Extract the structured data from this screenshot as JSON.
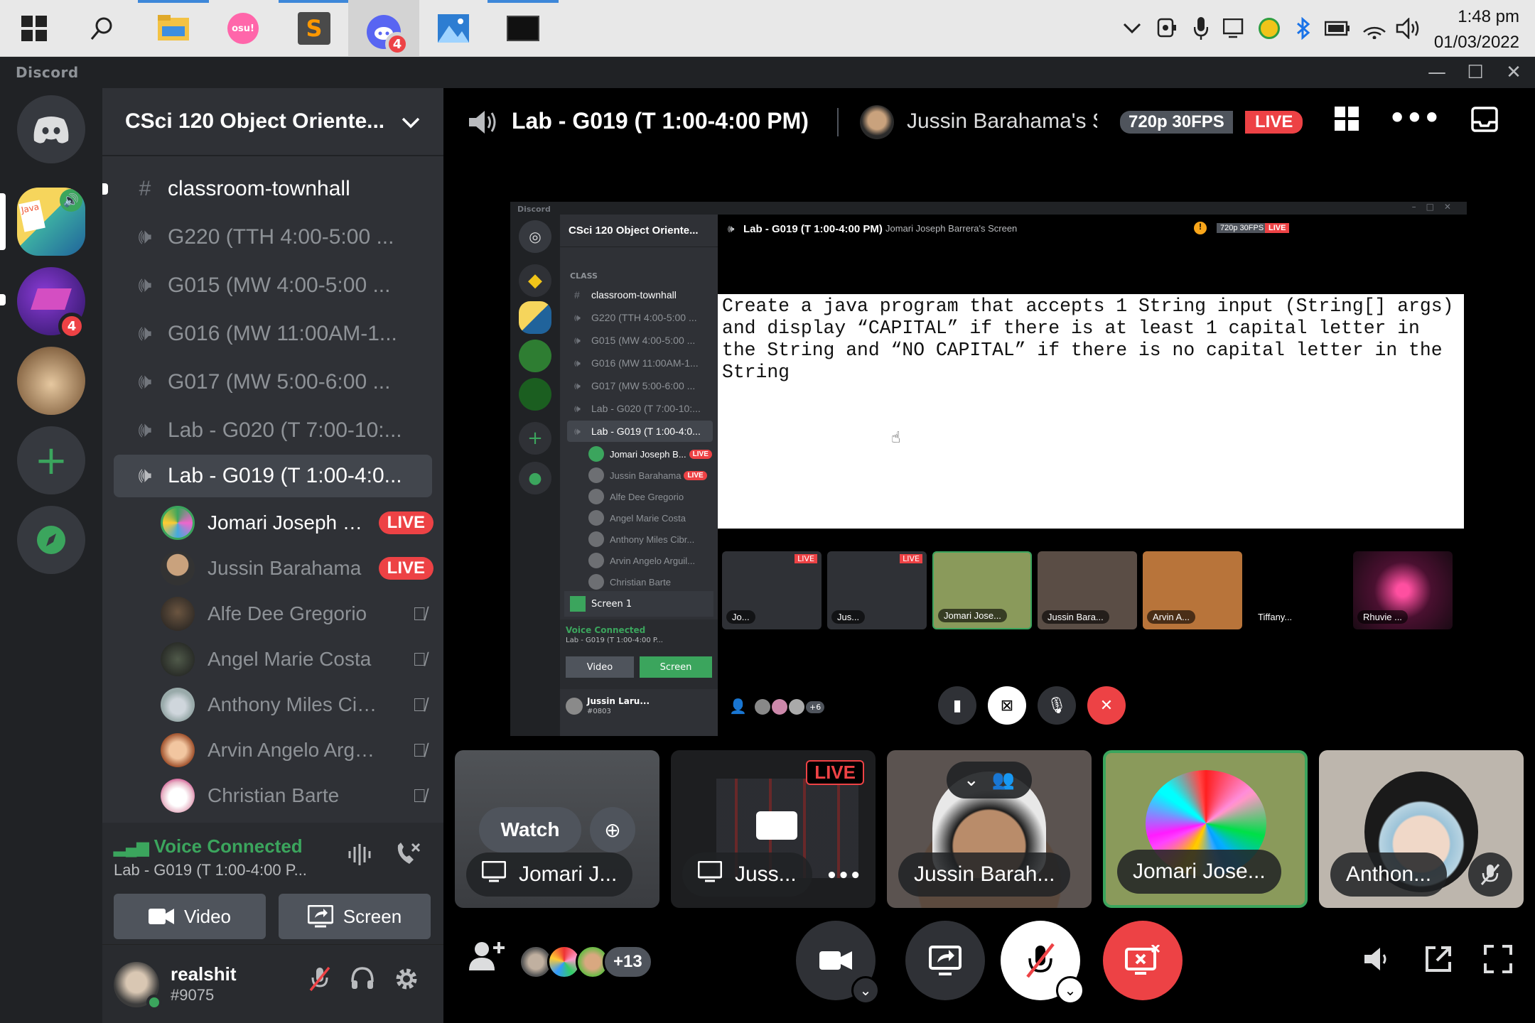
{
  "taskbar": {
    "clock_time": "1:48 pm",
    "clock_date": "01/03/2022",
    "discord_badge": "4",
    "osu_label": "osu!"
  },
  "titlebar": {
    "app_name": "Discord"
  },
  "server_rail": {
    "server2_badge": "4"
  },
  "sidebar": {
    "guild_name": "CSci 120 Object Oriente...",
    "channels": [
      {
        "name": "classroom-townhall"
      },
      {
        "name": "G220 (TTH 4:00-5:00 ..."
      },
      {
        "name": "G015 (MW 4:00-5:00 ..."
      },
      {
        "name": "G016 (MW 11:00AM-1..."
      },
      {
        "name": "G017 (MW 5:00-6:00 ..."
      },
      {
        "name": "Lab - G020 (T 7:00-10:..."
      },
      {
        "name": "Lab - G019 (T 1:00-4:0..."
      }
    ],
    "voice_users": [
      {
        "name": "Jomari Joseph B...",
        "live": "LIVE"
      },
      {
        "name": "Jussin Barahama",
        "live": "LIVE"
      },
      {
        "name": "Alfe Dee Gregorio"
      },
      {
        "name": "Angel Marie Costa"
      },
      {
        "name": "Anthony Miles Cibr..."
      },
      {
        "name": "Arvin Angelo Arguil..."
      },
      {
        "name": "Christian Barte"
      }
    ],
    "voice_panel": {
      "status": "Voice Connected",
      "channel": "Lab - G019 (T 1:00-4:00 P...",
      "video_label": "Video",
      "screen_label": "Screen"
    },
    "user": {
      "name": "realshit",
      "tag": "#9075"
    }
  },
  "stage": {
    "channel_title": "Lab - G019 (T 1:00-4:00 PM)",
    "stream_owner": "Jussin Barahama's Scr",
    "quality": "720p 30FPS",
    "live": "LIVE",
    "tiles": [
      {
        "name": "Jomari J...",
        "action": "Watch"
      },
      {
        "name": "Juss...",
        "live": "LIVE"
      },
      {
        "name": "Jussin Barah..."
      },
      {
        "name": "Jomari Jose..."
      },
      {
        "name": "Anthon..."
      }
    ],
    "participant_extra": "+13"
  },
  "inner_share": {
    "app_name": "Discord",
    "guild_name": "CSci 120 Object Oriente...",
    "category": "CLASS",
    "channels": [
      "classroom-townhall",
      "G220 (TTH 4:00-5:00 ...",
      "G015 (MW 4:00-5:00 ...",
      "G016 (MW 11:00AM-1...",
      "G017 (MW 5:00-6:00 ...",
      "Lab - G020 (T 7:00-10:...",
      "Lab - G019 (T 1:00-4:0..."
    ],
    "voice_users": [
      {
        "name": "Jomari Joseph B...",
        "live": "LIVE"
      },
      {
        "name": "Jussin Barahama",
        "live": "LIVE"
      },
      {
        "name": "Alfe Dee Gregorio"
      },
      {
        "name": "Angel Marie Costa"
      },
      {
        "name": "Anthony Miles Cibr..."
      },
      {
        "name": "Arvin Angelo Arguil..."
      },
      {
        "name": "Christian Barte"
      }
    ],
    "screen_label": "Screen 1",
    "voice_status": "Voice Connected",
    "voice_channel": "Lab - G019 (T 1:00-4:00 P...",
    "video_label": "Video",
    "screen_btn": "Screen",
    "user_name": "Jussin Laru...",
    "user_tag": "#0803",
    "header_title": "Lab - G019 (T 1:00-4:00 PM)",
    "header_stream": "Jomari Joseph Barrera's Screen",
    "quality": "720p 30FPS",
    "live": "LIVE",
    "document_text": "Create a java program that accepts 1 String input (String[] args) and display “CAPITAL” if there is at least 1 capital letter in the String and “NO CAPITAL” if there is no capital letter in the String",
    "tiles": [
      {
        "name": "Jo...",
        "live": "LIVE"
      },
      {
        "name": "Jus...",
        "live": "LIVE"
      },
      {
        "name": "Jomari Jose..."
      },
      {
        "name": "Jussin Bara..."
      },
      {
        "name": "Arvin A..."
      },
      {
        "name": "Tiffany..."
      },
      {
        "name": "Rhuvie ..."
      }
    ],
    "extra": "+6"
  },
  "colors": {
    "live_red": "#ed4245",
    "voice_green": "#3ba55d",
    "selected_bg": "#42464d",
    "sidebar_bg": "#2f3136",
    "rail_bg": "#202225"
  }
}
